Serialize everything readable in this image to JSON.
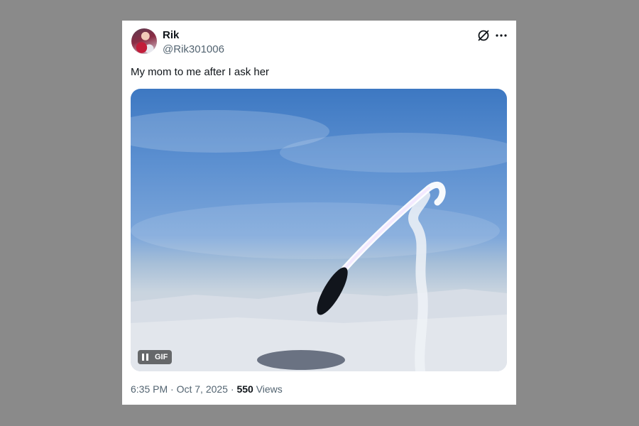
{
  "tweet": {
    "author_name": "Rik",
    "author_handle": "@Rik301006",
    "text": "My mom to me after I ask her",
    "media": {
      "type": "gif",
      "badge_label": "GIF",
      "playing": true
    },
    "time": "6:35 PM",
    "separator1": "·",
    "date": "Oct 7, 2025",
    "separator2": "·",
    "views_count": "550",
    "views_label": "Views"
  },
  "icons": {
    "grok": "grok-icon",
    "more": "more-icon",
    "pause": "pause-icon"
  },
  "colors": {
    "background": "#8a8a8a",
    "card": "#ffffff",
    "text_primary": "#0f1419",
    "text_secondary": "#536471"
  }
}
